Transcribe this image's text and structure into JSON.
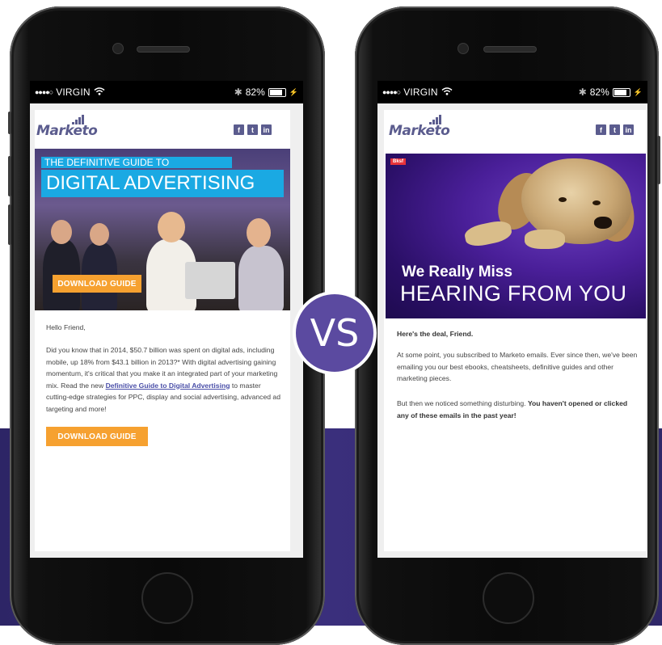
{
  "status_bar": {
    "carrier": "VIRGIN",
    "battery": "82%"
  },
  "left_email": {
    "brand": "Marketo",
    "social": [
      "f",
      "t",
      "in"
    ],
    "hero": {
      "subtitle": "THE DEFINITIVE GUIDE TO",
      "title": "DIGITAL ADVERTISING",
      "button": "DOWNLOAD GUIDE"
    },
    "greeting": "Hello Friend,",
    "body_pre": "Did you know that in 2014, $50.7 billion was spent on digital ads, including mobile, up 18% from $43.1 billion in 2013?* With digital advertising gaining momentum, it's critical that you make it an integrated part of your marketing mix. Read the new ",
    "body_link": "Definitive Guide to Digital Advertising",
    "body_post": " to master cutting-edge strategies for PPC, display and social advertising, advanced ad targeting and more!",
    "cta": "DOWNLOAD GUIDE"
  },
  "right_email": {
    "brand": "Marketo",
    "social": [
      "f",
      "t",
      "in"
    ],
    "hero": {
      "tag": "Bksf",
      "title_bold": "We Really Miss",
      "title_light": "HEARING FROM YOU"
    },
    "intro": "Here's the deal, Friend.",
    "para1": "At some point, you subscribed to Marketo emails. Ever since then, we've been emailing you our best ebooks, cheatsheets, definitive guides and other marketing pieces.",
    "para2_pre": "But then we noticed something disturbing. ",
    "para2_bold": "You haven't opened or clicked any of these emails in the past year!"
  },
  "badge": "VS",
  "colors": {
    "brand_purple": "#5b5c8e",
    "accent_blue": "#1aa9e3",
    "cta_orange": "#f6a130",
    "background_band": "#2d2566",
    "vs_badge": "#5b4aa0"
  }
}
